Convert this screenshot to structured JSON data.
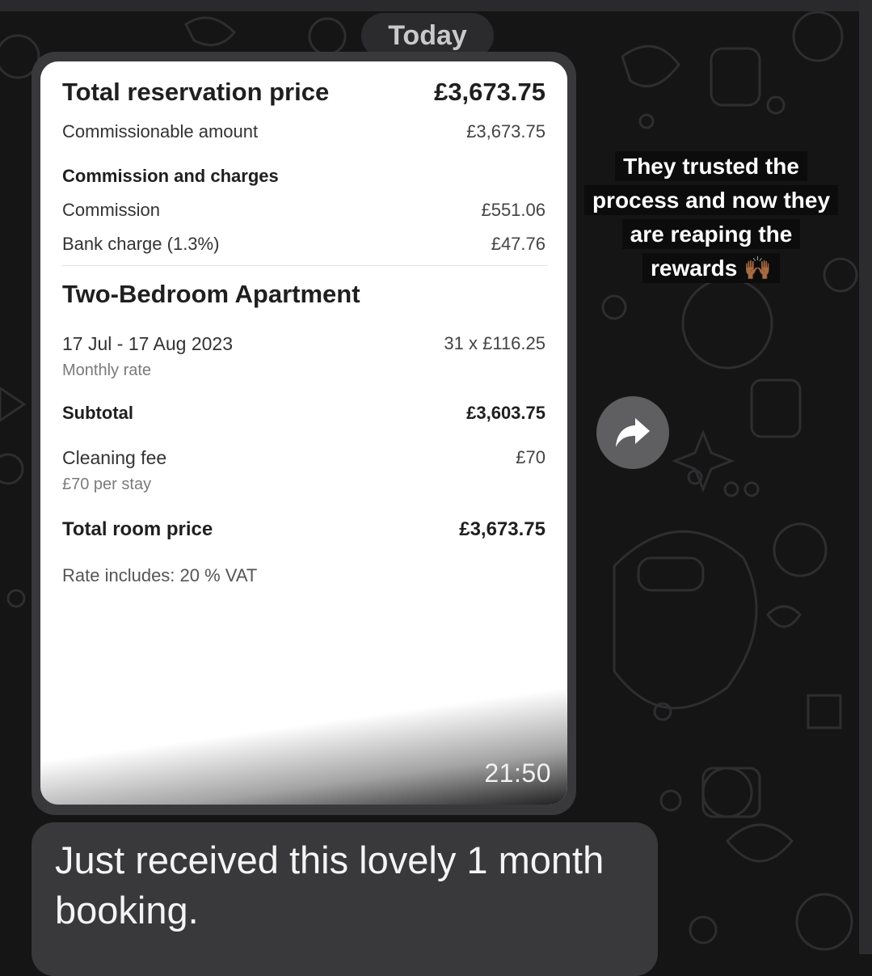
{
  "date_separator": "Today",
  "receipt": {
    "total_reservation_label": "Total reservation price",
    "total_reservation_value": "£3,673.75",
    "commissionable_label": "Commissionable amount",
    "commissionable_value": "£3,673.75",
    "commission_heading": "Commission and charges",
    "commission_label": "Commission",
    "commission_value": "£551.06",
    "bank_charge_label": "Bank charge (1.3%)",
    "bank_charge_value": "£47.76",
    "room_title": "Two-Bedroom Apartment",
    "dates_label": "17 Jul - 17 Aug 2023",
    "dates_value": "31 x £116.25",
    "dates_note": "Monthly rate",
    "subtotal_label": "Subtotal",
    "subtotal_value": "£3,603.75",
    "cleaning_label": "Cleaning fee",
    "cleaning_value": "£70",
    "cleaning_note": "£70 per stay",
    "total_room_label": "Total room price",
    "total_room_value": "£3,673.75",
    "vat_note": "Rate includes: 20 % VAT"
  },
  "image_message_time": "21:50",
  "caption_text": "They trusted the process and now they are reaping the rewards 🙌🏾",
  "text_message": "Just received this lovely 1 month booking.",
  "icons": {
    "forward": "forward-arrow-icon"
  },
  "colors": {
    "background": "#151515",
    "bubble": "#39393b",
    "forward_button": "#5f5f62"
  }
}
